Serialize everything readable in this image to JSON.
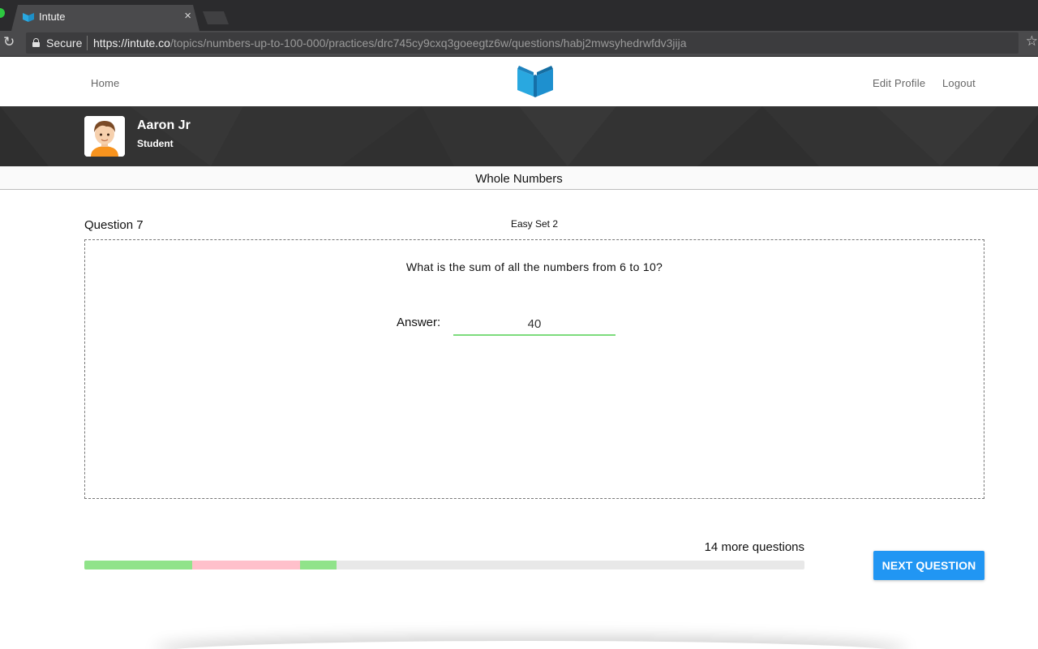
{
  "browser": {
    "tab_title": "Intute",
    "tab_close": "×",
    "secure_label": "Secure",
    "url_scheme": "https://",
    "url_host": "intute.co",
    "url_path": "/topics/numbers-up-to-100-000/practices/drc745cy9cxq3goeegtz6w/questions/habj2mwsyhedrwfdv3jija",
    "reload_icon": "reload-icon",
    "bookmark_icon": "star-icon"
  },
  "header": {
    "home_label": "Home",
    "edit_profile_label": "Edit Profile",
    "logout_label": "Logout",
    "logo_icon": "open-book-icon",
    "brand_color": "#29a8e0"
  },
  "profile": {
    "name": "Aaron Jr",
    "role": "Student"
  },
  "topic": {
    "title": "Whole Numbers"
  },
  "question": {
    "number_label": "Question 7",
    "set_label": "Easy Set 2",
    "text": "What is the sum of all the numbers from 6 to 10?",
    "answer_label": "Answer:",
    "answer_value": "40"
  },
  "progress": {
    "remaining_label": "14 more questions",
    "total_fraction_done": 0.35,
    "segments": [
      {
        "status": "correct",
        "color": "#90e38a",
        "fraction": 0.15
      },
      {
        "status": "incorrect",
        "color": "#ffc0cb",
        "fraction": 0.15
      },
      {
        "status": "correct",
        "color": "#90e38a",
        "fraction": 0.05
      }
    ]
  },
  "actions": {
    "next_label": "NEXT QUESTION",
    "accent_color": "#2196f3"
  }
}
